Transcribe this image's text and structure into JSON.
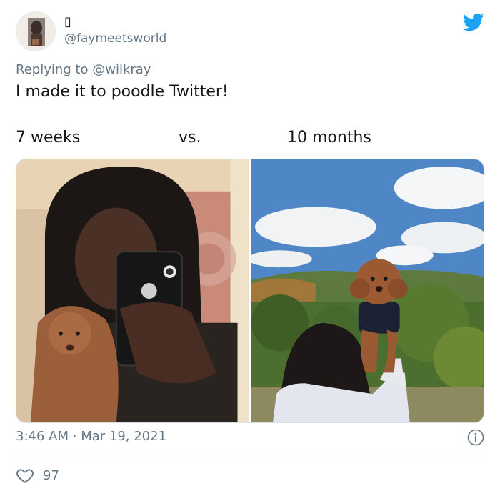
{
  "author": {
    "display_name": "▯",
    "handle": "@faymeetsworld"
  },
  "reply": {
    "prefix": "Replying to",
    "mention": "@wilkray"
  },
  "tweet": {
    "text": "I made it to poodle Twitter!",
    "caption_left": "7 weeks",
    "caption_mid": "vs.",
    "caption_right": "10 months"
  },
  "meta": {
    "time": "3:46 AM",
    "separator": "·",
    "date": "Mar 19, 2021"
  },
  "engagement": {
    "likes": "97"
  },
  "icons": {
    "brand": "twitter-bird-icon",
    "info": "info-icon",
    "like": "heart-icon"
  },
  "colors": {
    "brand": "#1da1f2",
    "secondary_text": "#657786",
    "primary_text": "#14171a",
    "border": "#e6ecf0"
  }
}
